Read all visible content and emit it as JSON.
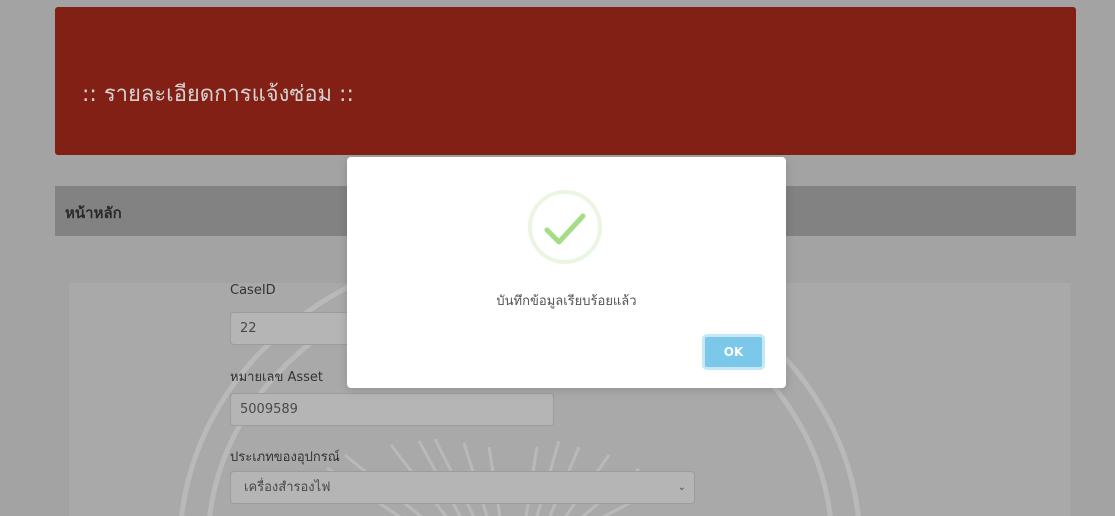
{
  "header": {
    "title": ":: รายละเอียดการแจ้งซ่อม ::"
  },
  "breadcrumb": {
    "home": "หน้าหลัก"
  },
  "form": {
    "case_id": {
      "label": "CaseID",
      "value": "22"
    },
    "asset_number": {
      "label": "หมายเลข Asset",
      "value": "5009589"
    },
    "device_type": {
      "label": "ประเภทของอุปกรณ์",
      "selected": "เครื่องสำรองไฟ"
    }
  },
  "modal": {
    "message": "บันทึกข้อมูลเรียบร้อยแล้ว",
    "ok_label": "OK",
    "icon": "checkmark-circle-icon",
    "icon_color": "#a5dc86",
    "button_color": "#7cc8ea"
  },
  "colors": {
    "header_background": "#822016",
    "overlay_background": "#a3a3a3"
  }
}
